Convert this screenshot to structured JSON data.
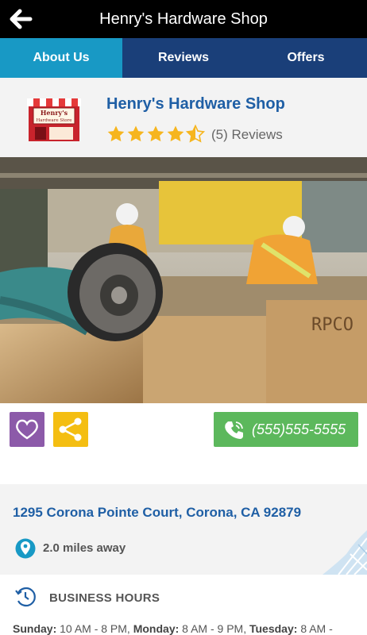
{
  "header": {
    "title": "Henry's Hardware Shop"
  },
  "tabs": [
    {
      "label": "About Us",
      "active": true
    },
    {
      "label": "Reviews",
      "active": false
    },
    {
      "label": "Offers",
      "active": false
    }
  ],
  "business": {
    "name": "Henry's Hardware Shop",
    "logo_text": [
      "Henry's",
      "Hardware Store"
    ],
    "rating": 4.5,
    "reviews_label": "(5) Reviews"
  },
  "hero_image": {
    "crate_text": "RPCO"
  },
  "actions": {
    "phone": "(555)555-5555"
  },
  "address": {
    "line": "1295 Corona Pointe Court, Corona, CA 92879",
    "distance": "2.0 miles away"
  },
  "hours": {
    "title": "BUSINESS HOURS",
    "entries": [
      {
        "day": "Sunday:",
        "time": "10 AM - 8 PM,"
      },
      {
        "day": "Monday:",
        "time": "8 AM - 9 PM,"
      },
      {
        "day": "Tuesday:",
        "time": "8 AM -"
      }
    ]
  },
  "colors": {
    "topbar": "#000000",
    "tab_active": "#1899c5",
    "tab_inactive": "#1a3f79",
    "title_blue": "#1f5fa5",
    "star": "#f6b51e",
    "favorite": "#8c5aa9",
    "share": "#f4be12",
    "call": "#5cb85c"
  },
  "icons": [
    "back-arrow-icon",
    "star-icon",
    "heart-icon",
    "share-icon",
    "phone-icon",
    "location-pin-icon",
    "clock-icon"
  ]
}
